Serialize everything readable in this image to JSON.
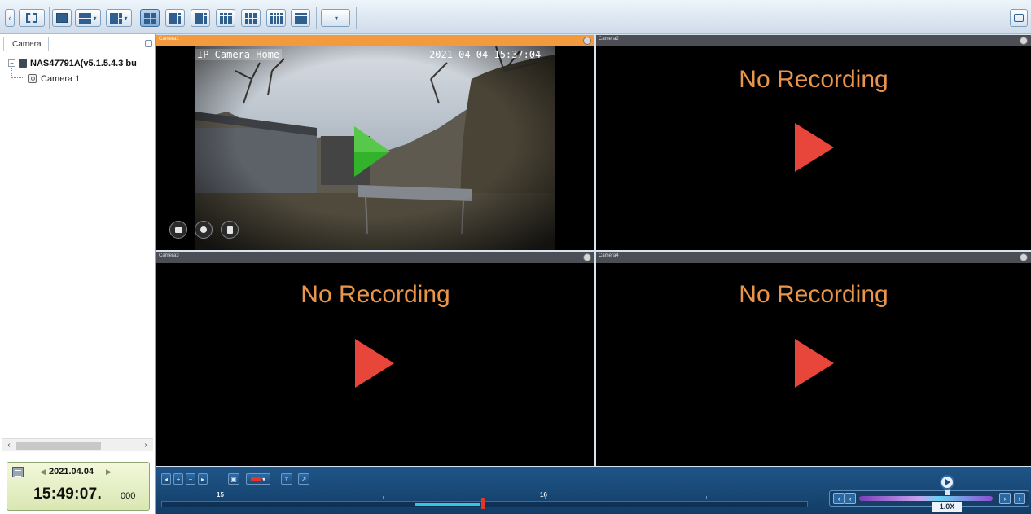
{
  "left_panel": {
    "tab_label": "Camera",
    "tree": {
      "root_label": "NAS47791A(v5.1.5.4.3 bu",
      "children": [
        "Camera 1"
      ]
    },
    "clock": {
      "date": "2021.04.04",
      "time": "15:49:07.",
      "milliseconds": "000"
    }
  },
  "panes": [
    {
      "title": "Camera1",
      "selected": true,
      "osd_title": "IP Camera Home",
      "osd_time": "2021-04-04 15:37:04"
    },
    {
      "title": "Camera2",
      "selected": false,
      "message": "No Recording"
    },
    {
      "title": "Camera3",
      "selected": false,
      "message": "No Recording"
    },
    {
      "title": "Camera4",
      "selected": false,
      "message": "No Recording"
    }
  ],
  "timeline": {
    "hour_labels": [
      "15",
      "16"
    ],
    "speed_label": "1.0X"
  },
  "colors": {
    "selected_header": "#f29a3d",
    "no_recording_text": "#e9964c",
    "play_red": "#e8463b",
    "play_green": "#33b32b",
    "timeline_bg": "#1f5587",
    "recorded_segment": "#33c6e3",
    "cursor": "#e43628"
  },
  "icons": {
    "toolbar": [
      "left-arrow-icon",
      "fullscreen-icon",
      "single-layout-icon",
      "split-layout-icon",
      "multi-layout-icon",
      "quad-layout-icon",
      "grid-layout-icon",
      "snapshot-icon"
    ],
    "pane_tools": [
      "record-icon",
      "zoom-icon",
      "info-icon"
    ]
  }
}
